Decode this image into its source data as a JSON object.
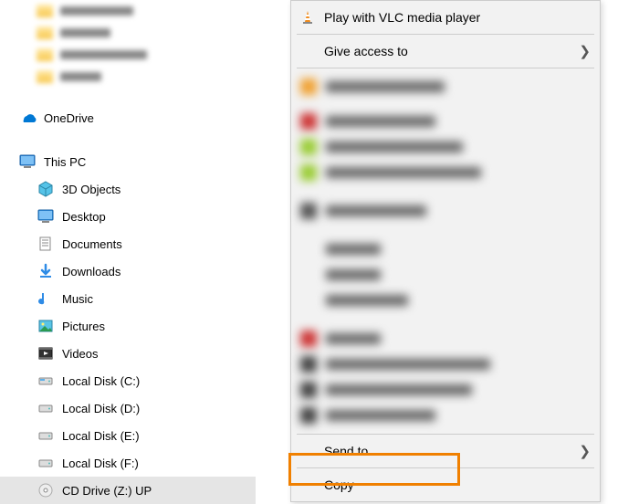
{
  "sidebar": {
    "onedrive": "OneDrive",
    "thispc": "This PC",
    "items": [
      {
        "label": "3D Objects"
      },
      {
        "label": "Desktop"
      },
      {
        "label": "Documents"
      },
      {
        "label": "Downloads"
      },
      {
        "label": "Music"
      },
      {
        "label": "Pictures"
      },
      {
        "label": "Videos"
      },
      {
        "label": "Local Disk (C:)"
      },
      {
        "label": "Local Disk (D:)"
      },
      {
        "label": "Local Disk (E:)"
      },
      {
        "label": "Local Disk (F:)"
      },
      {
        "label": "CD Drive (Z:) UP"
      }
    ]
  },
  "menu": {
    "vlc": "Play with VLC media player",
    "give_access": "Give access to",
    "send_to": "Send to",
    "copy": "Copy"
  }
}
